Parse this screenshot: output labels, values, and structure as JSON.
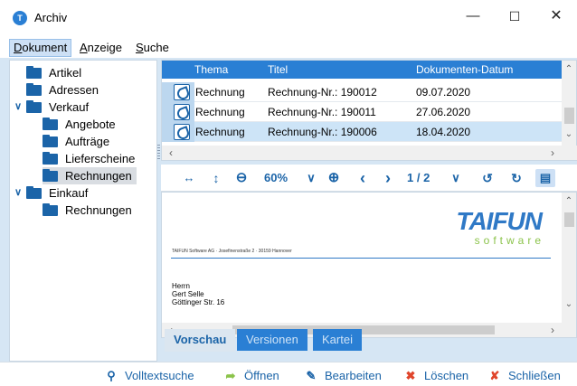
{
  "window": {
    "title": "Archiv",
    "icon": "taifun-app-icon"
  },
  "menu": [
    {
      "label_mnem": "D",
      "label_rest": "okument"
    },
    {
      "label_mnem": "A",
      "label_rest": "nzeige"
    },
    {
      "label_mnem": "S",
      "label_rest": "uche"
    }
  ],
  "tree": [
    {
      "label": "Artikel"
    },
    {
      "label": "Adressen"
    },
    {
      "label": "Verkauf"
    },
    {
      "label": "Angebote"
    },
    {
      "label": "Aufträge"
    },
    {
      "label": "Lieferscheine"
    },
    {
      "label": "Rechnungen"
    },
    {
      "label": "Einkauf"
    },
    {
      "label": "Rechnungen"
    }
  ],
  "grid": {
    "headers": [
      "Thema",
      "Titel",
      "Dokumenten-Datum"
    ],
    "rows": [
      {
        "thema": "Rechnung",
        "titel": "Rechnung-Nr.: 190012",
        "datum": "09.07.2020"
      },
      {
        "thema": "Rechnung",
        "titel": "Rechnung-Nr.: 190011",
        "datum": "27.06.2020"
      },
      {
        "thema": "Rechnung",
        "titel": "Rechnung-Nr.: 190006",
        "datum": "18.04.2020"
      }
    ]
  },
  "viewer": {
    "zoom": "60%",
    "page": "1 / 2"
  },
  "document": {
    "logo": "TAIFUN",
    "logo_sub": "software",
    "sender_line": "TAIFUN Software AG · Josefinenstraße 2 · 30159 Hannover",
    "address": [
      "Herrn",
      "Gert Selle",
      "Göttinger Str. 16"
    ]
  },
  "tabs": [
    "Vorschau",
    "Versionen",
    "Kartei"
  ],
  "actions": [
    {
      "label": "Volltextsuche",
      "icon": "search-icon"
    },
    {
      "label": "Öffnen",
      "icon": "open-icon"
    },
    {
      "label": "Bearbeiten",
      "icon": "edit-icon"
    },
    {
      "label": "Löschen",
      "icon": "delete-icon"
    },
    {
      "label": "Schließen",
      "icon": "close-icon"
    }
  ],
  "colors": {
    "accent": "#2a7fd4",
    "brand_blue": "#1b64a8",
    "background": "#d6e6f4",
    "brand_green": "#8bc34a",
    "delete_red": "#e0452b"
  }
}
